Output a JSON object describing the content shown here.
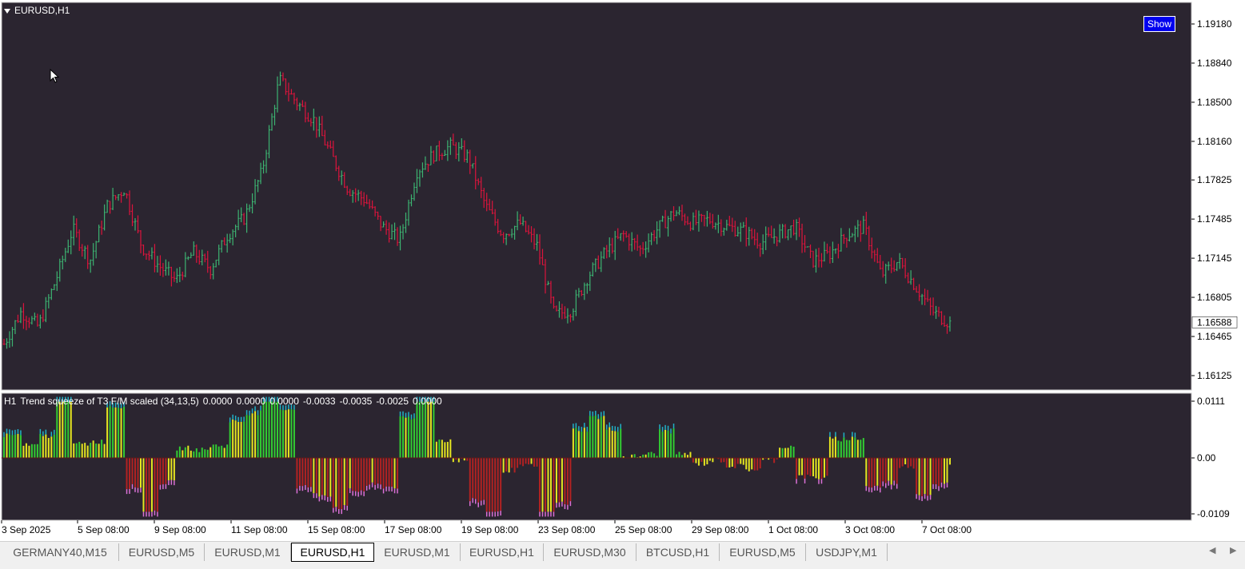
{
  "window": {
    "symbol_label": "EURUSD,H1",
    "show_button_label": "Show"
  },
  "price_axis": {
    "ticks": [
      "1.19180",
      "1.18840",
      "1.18500",
      "1.18160",
      "1.17825",
      "1.17485",
      "1.17145",
      "1.16805",
      "1.16465",
      "1.16125"
    ],
    "current_price": "1.16588"
  },
  "indicator": {
    "prefix": "H1",
    "name": "Trend squeeze of T3 F/M scaled (34,13,5)",
    "values": [
      "0.0000",
      "0.0000",
      "0.0000",
      "-0.0033",
      "-0.0035",
      "-0.0025",
      "0.0000"
    ],
    "axis_ticks": [
      "0.0111",
      "0.00",
      "-0.0109"
    ]
  },
  "time_axis": {
    "labels": [
      "3 Sep 2025",
      "5 Sep 08:00",
      "9 Sep 08:00",
      "11 Sep 08:00",
      "15 Sep 08:00",
      "17 Sep 08:00",
      "19 Sep 08:00",
      "23 Sep 08:00",
      "25 Sep 08:00",
      "29 Sep 08:00",
      "1 Oct 08:00",
      "3 Oct 08:00",
      "7 Oct 08:00"
    ]
  },
  "tabs": [
    {
      "label": "GERMANY40,M15",
      "active": false
    },
    {
      "label": "EURUSD,M5",
      "active": false
    },
    {
      "label": "EURUSD,M1",
      "active": false
    },
    {
      "label": "EURUSD,H1",
      "active": true
    },
    {
      "label": "EURUSD,M1",
      "active": false
    },
    {
      "label": "EURUSD,H1",
      "active": false
    },
    {
      "label": "EURUSD,M30",
      "active": false
    },
    {
      "label": "BTCUSD,H1",
      "active": false
    },
    {
      "label": "EURUSD,M5",
      "active": false
    },
    {
      "label": "USDJPY,M1",
      "active": false
    }
  ],
  "colors": {
    "background": "#2b2530",
    "bull_bar": "#3cb371",
    "bear_bar": "#dc143c",
    "osc_green": "#32cd32",
    "osc_dark_green": "#1e6e1e",
    "osc_red": "#b22222",
    "osc_dark_red": "#5a1a1a",
    "osc_yellow": "#e6e620",
    "osc_cyan": "#20b2c8",
    "osc_pink": "#da70d6"
  },
  "chart_data": {
    "type": "line",
    "title": "EURUSD,H1",
    "ylim": [
      1.16125,
      1.1918
    ],
    "x": [
      "3 Sep 2025",
      "5 Sep 08:00",
      "9 Sep 08:00",
      "11 Sep 08:00",
      "15 Sep 08:00",
      "17 Sep 08:00",
      "19 Sep 08:00",
      "23 Sep 08:00",
      "25 Sep 08:00",
      "29 Sep 08:00",
      "1 Oct 08:00",
      "3 Oct 08:00",
      "7 Oct 08:00"
    ],
    "series": [
      {
        "values": [
          1.164,
          1.1695,
          1.1718,
          1.17,
          1.1758,
          1.1875,
          1.179,
          1.1815,
          1.166,
          1.1735,
          1.1755,
          1.1745,
          1.1658
        ]
      }
    ],
    "close_path": [
      1.164,
      1.1668,
      1.1655,
      1.1695,
      1.174,
      1.1712,
      1.176,
      1.1775,
      1.1725,
      1.1708,
      1.1695,
      1.172,
      1.1705,
      1.1735,
      1.175,
      1.179,
      1.187,
      1.185,
      1.1835,
      1.1805,
      1.1775,
      1.1765,
      1.1742,
      1.173,
      1.179,
      1.1805,
      1.1812,
      1.1802,
      1.176,
      1.1735,
      1.1745,
      1.1725,
      1.1665,
      1.167,
      1.17,
      1.172,
      1.1735,
      1.1722,
      1.174,
      1.1755,
      1.1745,
      1.1748,
      1.1742,
      1.1738,
      1.1728,
      1.1735,
      1.1742,
      1.1712,
      1.1718,
      1.1735,
      1.1742,
      1.17,
      1.1712,
      1.169,
      1.1668,
      1.1658
    ]
  }
}
